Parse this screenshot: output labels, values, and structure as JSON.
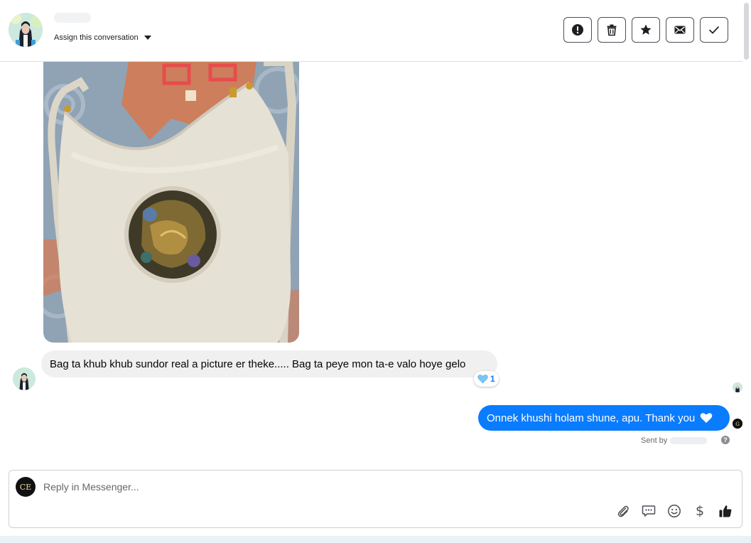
{
  "header": {
    "assign_label": "Assign this conversation",
    "toolbar": [
      {
        "name": "mark-spam-button",
        "icon": "alert-circle-icon"
      },
      {
        "name": "delete-button",
        "icon": "trash-icon"
      },
      {
        "name": "star-button",
        "icon": "star-icon"
      },
      {
        "name": "mark-unread-button",
        "icon": "envelope-icon"
      },
      {
        "name": "mark-done-button",
        "icon": "check-icon"
      }
    ]
  },
  "conversation": {
    "incoming_message": "Bag ta khub khub sundor real a picture er theke..... Bag ta peye mon ta-e valo hoye gelo",
    "reaction": {
      "icon": "blue-heart-icon",
      "count": "1"
    },
    "outgoing_message": "Onnek khushi holam shune, apu. Thank you",
    "outgoing_emoji": "white-heart-icon",
    "sent_by_label": "Sent by",
    "help_glyph": "?"
  },
  "composer": {
    "avatar_initials": "CE",
    "placeholder": "Reply in Messenger...",
    "tools": [
      "paperclip-icon",
      "saved-reply-icon",
      "emoji-icon",
      "dollar-icon",
      "thumbs-up-icon"
    ],
    "dollar_glyph": "$"
  },
  "colors": {
    "outgoing_bubble": "#0a7cff",
    "incoming_bubble": "#f0f0f0",
    "reaction_count": "#1877f2"
  }
}
